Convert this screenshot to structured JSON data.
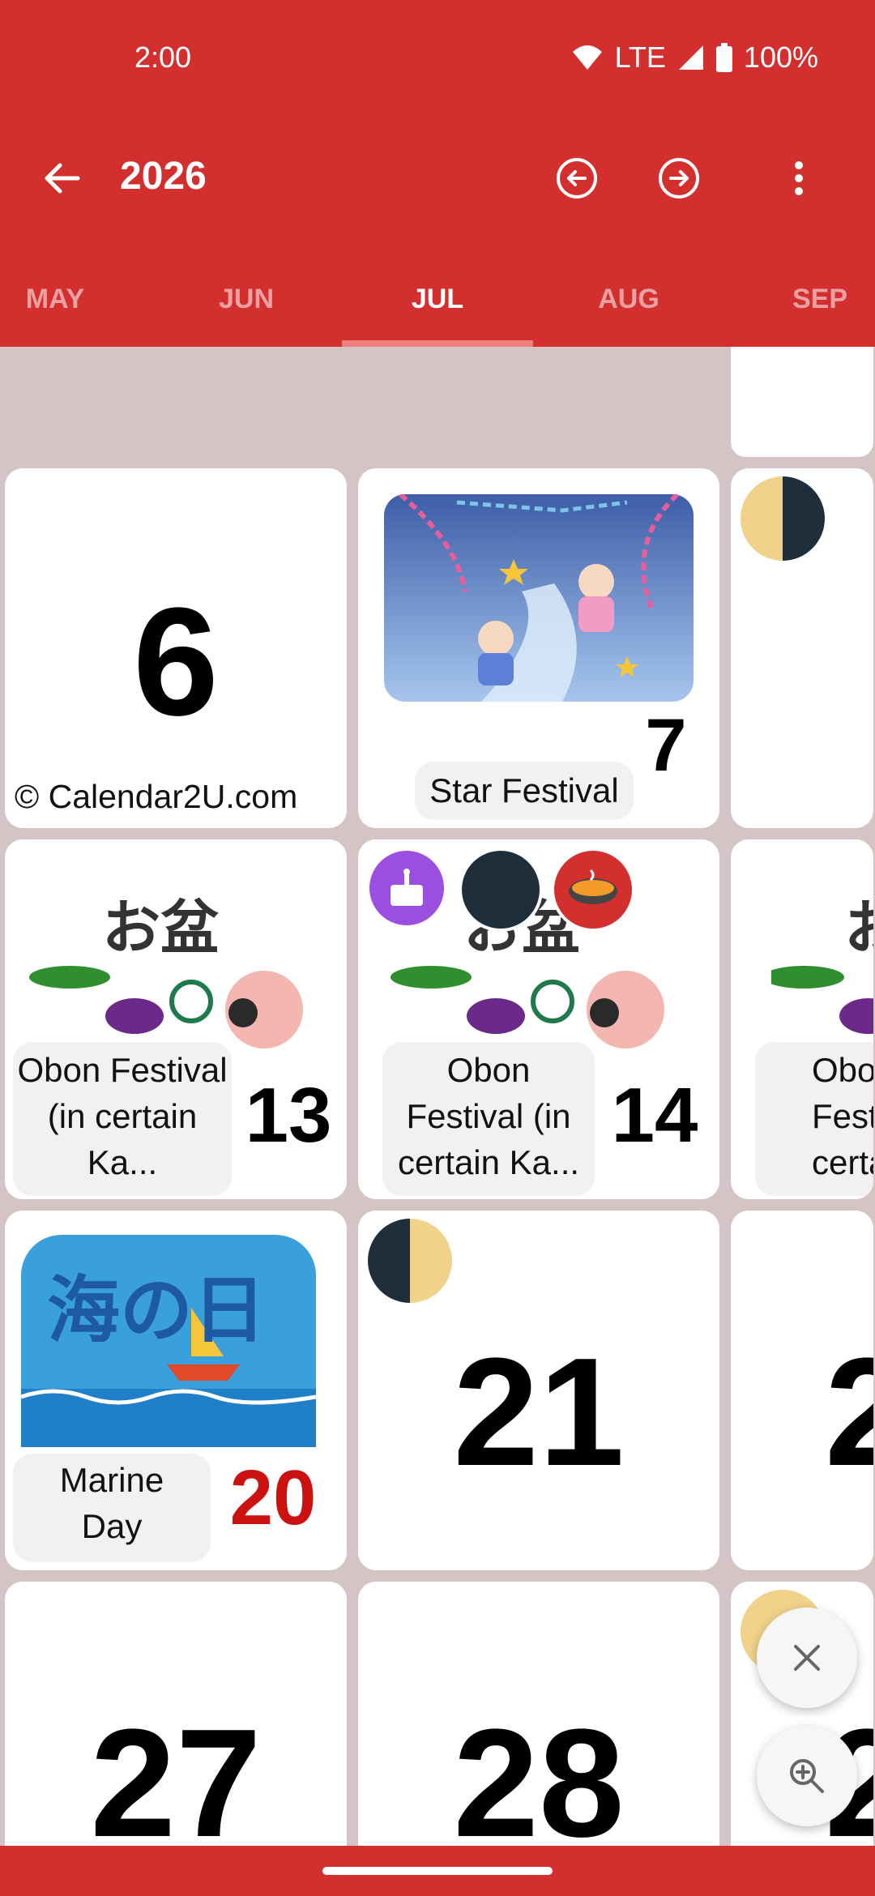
{
  "status": {
    "time": "2:00",
    "network": "LTE",
    "battery": "100%"
  },
  "toolbar": {
    "year": "2026"
  },
  "tabs": [
    "MAY",
    "JUN",
    "JUL",
    "AUG",
    "SEP"
  ],
  "active_tab": "JUL",
  "cells": {
    "d6": {
      "day": "6",
      "copyright": "© Calendar2U.com"
    },
    "d7": {
      "day": "7",
      "event": "Star Festival"
    },
    "d13": {
      "day": "13",
      "event": "Obon Festival (in certain Ka...",
      "image_text": "お盆"
    },
    "d14": {
      "day": "14",
      "event": "Obon Festival (in certain Ka...",
      "image_text": "お盆"
    },
    "d15": {
      "event_partial": "Obo Festiv certair",
      "image_text": "お"
    },
    "d20": {
      "day": "20",
      "event": "Marine Day",
      "image_text": "海の日"
    },
    "d21": {
      "day": "21"
    },
    "d22": {
      "day_partial": "2"
    },
    "d27": {
      "day": "27"
    },
    "d28": {
      "day": "28"
    },
    "d29": {
      "day_partial": "2"
    }
  },
  "colors": {
    "primary": "#d32f2f",
    "holiday": "#cc1111"
  },
  "icons": [
    "back-arrow-icon",
    "previous-circle-icon",
    "next-circle-icon",
    "more-vert-icon",
    "birthday-cake-icon",
    "new-moon-icon",
    "hotpot-icon",
    "close-icon",
    "zoom-in-icon"
  ]
}
